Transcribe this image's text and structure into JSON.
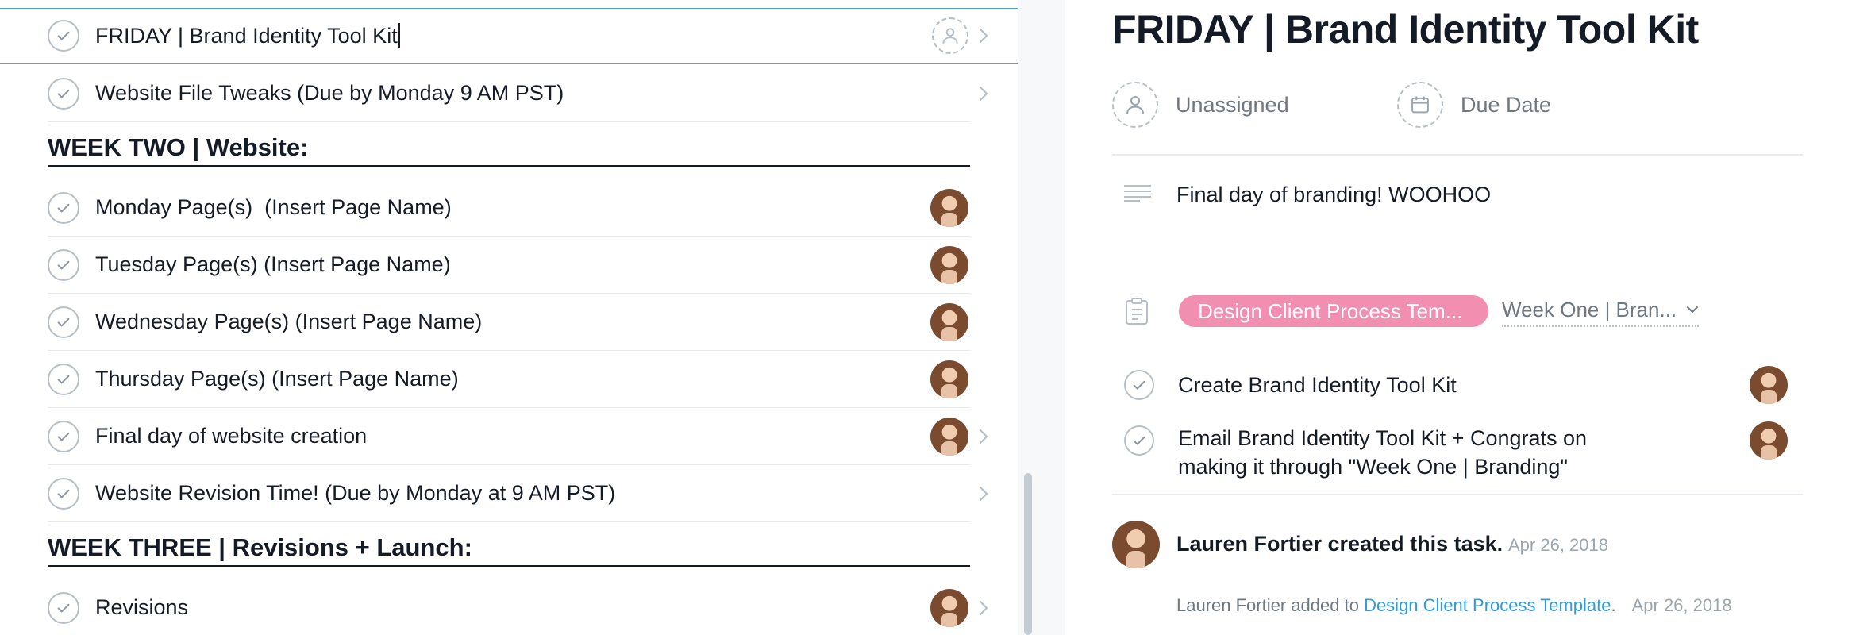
{
  "task_list": {
    "rows": [
      {
        "label": "FRIDAY | Brand Identity Tool Kit"
      },
      {
        "label": "Website File Tweaks (Due by Monday 9 AM PST)"
      },
      {
        "label": "Monday Page(s)  (Insert Page Name)"
      },
      {
        "label": "Tuesday Page(s) (Insert Page Name)"
      },
      {
        "label": "Wednesday Page(s) (Insert Page Name)"
      },
      {
        "label": "Thursday Page(s) (Insert Page Name)"
      },
      {
        "label": "Final day of website creation"
      },
      {
        "label": "Website Revision Time! (Due by Monday at 9 AM PST)"
      },
      {
        "label": "Revisions"
      }
    ],
    "sections": [
      {
        "title": "WEEK TWO | Website:"
      },
      {
        "title": "WEEK THREE | Revisions + Launch:"
      }
    ]
  },
  "detail": {
    "title": "FRIDAY | Brand Identity Tool Kit",
    "assignee_label": "Unassigned",
    "due_date_label": "Due Date",
    "description": "Final day of branding! WOOHOO",
    "project_pill": "Design Client Process Tem...",
    "section_select": "Week One | Bran...",
    "subtasks": [
      {
        "line1": "Create Brand Identity Tool Kit",
        "line2": ""
      },
      {
        "line1": "Email Brand Identity Tool Kit + Congrats on",
        "line2": "making it through \"Week One | Branding\""
      }
    ],
    "story": {
      "author_text": "Lauren Fortier created this task.",
      "date": "Apr 26, 2018"
    },
    "activity": {
      "actor": "Lauren Fortier",
      "verb": " added to ",
      "project": "Design Client Process Template",
      "period": ".",
      "date": "Apr 26, 2018"
    }
  },
  "colors": {
    "accent_blue": "#4fa3e0",
    "project_pink": "#f28fb0",
    "link_blue": "#2d9cdb"
  }
}
